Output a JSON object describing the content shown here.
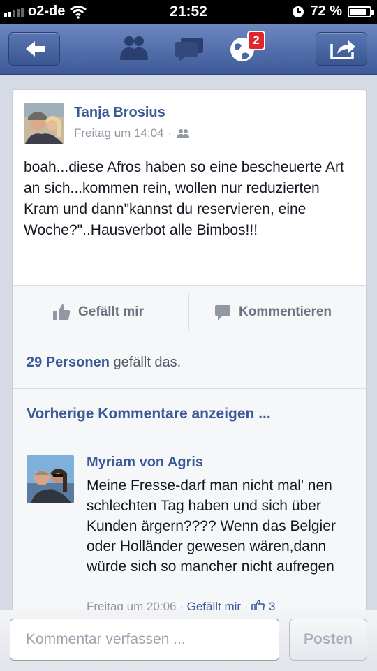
{
  "status_bar": {
    "carrier": "o2-de",
    "time": "21:52",
    "battery": "72 %",
    "signal_bars": 2,
    "signal_bars_total": 5
  },
  "nav": {
    "notification_count": "2",
    "colors": {
      "bar": "#4b67a7",
      "badge": "#e0262c"
    }
  },
  "post": {
    "author": "Tanja Brosius",
    "time": "Freitag um 14:04",
    "separator": "·",
    "audience_icon": "friends-icon",
    "text": "boah...diese Afros haben so eine bescheuerte Art an sich...kommen rein, wollen nur reduzierten Kram und dann\"kannst du reservieren, eine Woche?\"..Hausverbot alle Bimbos!!!"
  },
  "actions": {
    "like": "Gefällt mir",
    "comment": "Kommentieren"
  },
  "likes": {
    "count": "29 Personen",
    "suffix": " gefällt das."
  },
  "previous_comments": "Vorherige Kommentare anzeigen ...",
  "comment": {
    "author": "Myriam von Agris",
    "text": "Meine Fresse-darf man nicht mal' nen schlechten Tag haben und sich über Kunden ärgern????   Wenn das Belgier oder Holländer gewesen wären,dann würde sich so mancher nicht aufregen",
    "time": "Freitag um 20:06",
    "sep1": " · ",
    "like_link": "Gefällt mir",
    "sep2": " · ",
    "like_count": "3"
  },
  "compose": {
    "placeholder": "Kommentar verfassen ...",
    "post_button": "Posten"
  }
}
